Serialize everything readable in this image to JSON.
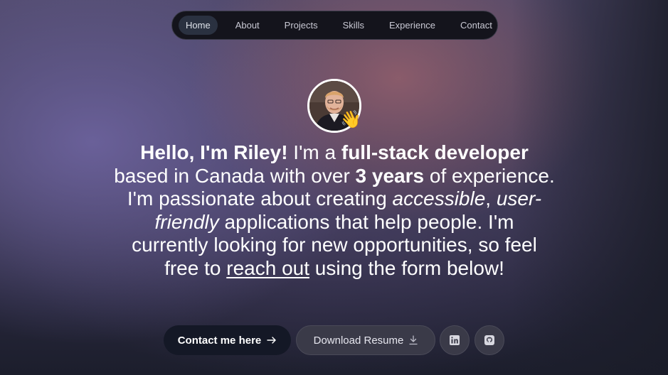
{
  "nav": {
    "items": [
      {
        "label": "Home",
        "active": true
      },
      {
        "label": "About",
        "active": false
      },
      {
        "label": "Projects",
        "active": false
      },
      {
        "label": "Skills",
        "active": false
      },
      {
        "label": "Experience",
        "active": false
      },
      {
        "label": "Contact",
        "active": false
      }
    ]
  },
  "avatar": {
    "badge_emoji": "👋",
    "alt_icon": "profile-photo"
  },
  "intro": {
    "greeting": "Hello, I'm Riley!",
    "t1": " I'm a ",
    "role": "full-stack developer",
    "t2": " based in Canada with over ",
    "years": "3 years",
    "t3": " of experience. I'm passionate about creating ",
    "accessible": "accessible",
    "t4": ", ",
    "user_friendly": "user-friendly",
    "t5": " applications that help people. I'm currently looking for new opportunities, so feel free to ",
    "reach_out": "reach out",
    "t6": " using the form below!"
  },
  "buttons": {
    "contact_label": "Contact me here",
    "contact_icon": "arrow-right-icon",
    "resume_label": "Download Resume",
    "resume_icon": "download-icon",
    "linkedin_icon": "linkedin-icon",
    "github_icon": "github-icon"
  },
  "colors": {
    "nav_bg": "#14141c",
    "active_pill": "#2a3140",
    "primary_button": "#141826",
    "secondary_button": "#3a3a48"
  }
}
